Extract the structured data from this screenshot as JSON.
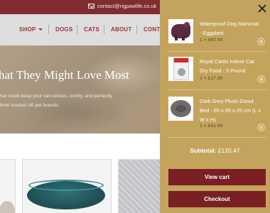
{
  "topbar": {
    "email": "contact@rigpawlife.co.uk",
    "email_icon": "mail-icon"
  },
  "nav": {
    "items": [
      {
        "label": "SHOP",
        "has_dropdown": true
      },
      {
        "label": "DOGS"
      },
      {
        "label": "CATS"
      },
      {
        "label": "ABOUT"
      },
      {
        "label": "CONT"
      }
    ]
  },
  "hero": {
    "title": "hat They Might Love Most",
    "text_line1": "hat could keep your cat curious, comfy, and perfectly",
    "text_line2": "from trusted UK pet brands."
  },
  "cart": {
    "close_icon": "close-icon",
    "items": [
      {
        "name": "Waterproof Dog Raincoat - Eggplant",
        "qty": "1 × £60.99"
      },
      {
        "name": "Royal Canin Indoor Cat Dry Food - 3 Pound",
        "qty": "1 × £17.99"
      },
      {
        "name": "Dark Grey Plush Donut Bed - 65 x 65 x 25 cm (L x W x H)",
        "qty": "1 × £41.49"
      }
    ],
    "subtotal_label": "Subtotal:",
    "subtotal_value": "£120.47",
    "view_cart": "View cart",
    "checkout": "Checkout"
  },
  "colors": {
    "brand": "#7a1f24",
    "cart_bg": "#c4a45c"
  }
}
